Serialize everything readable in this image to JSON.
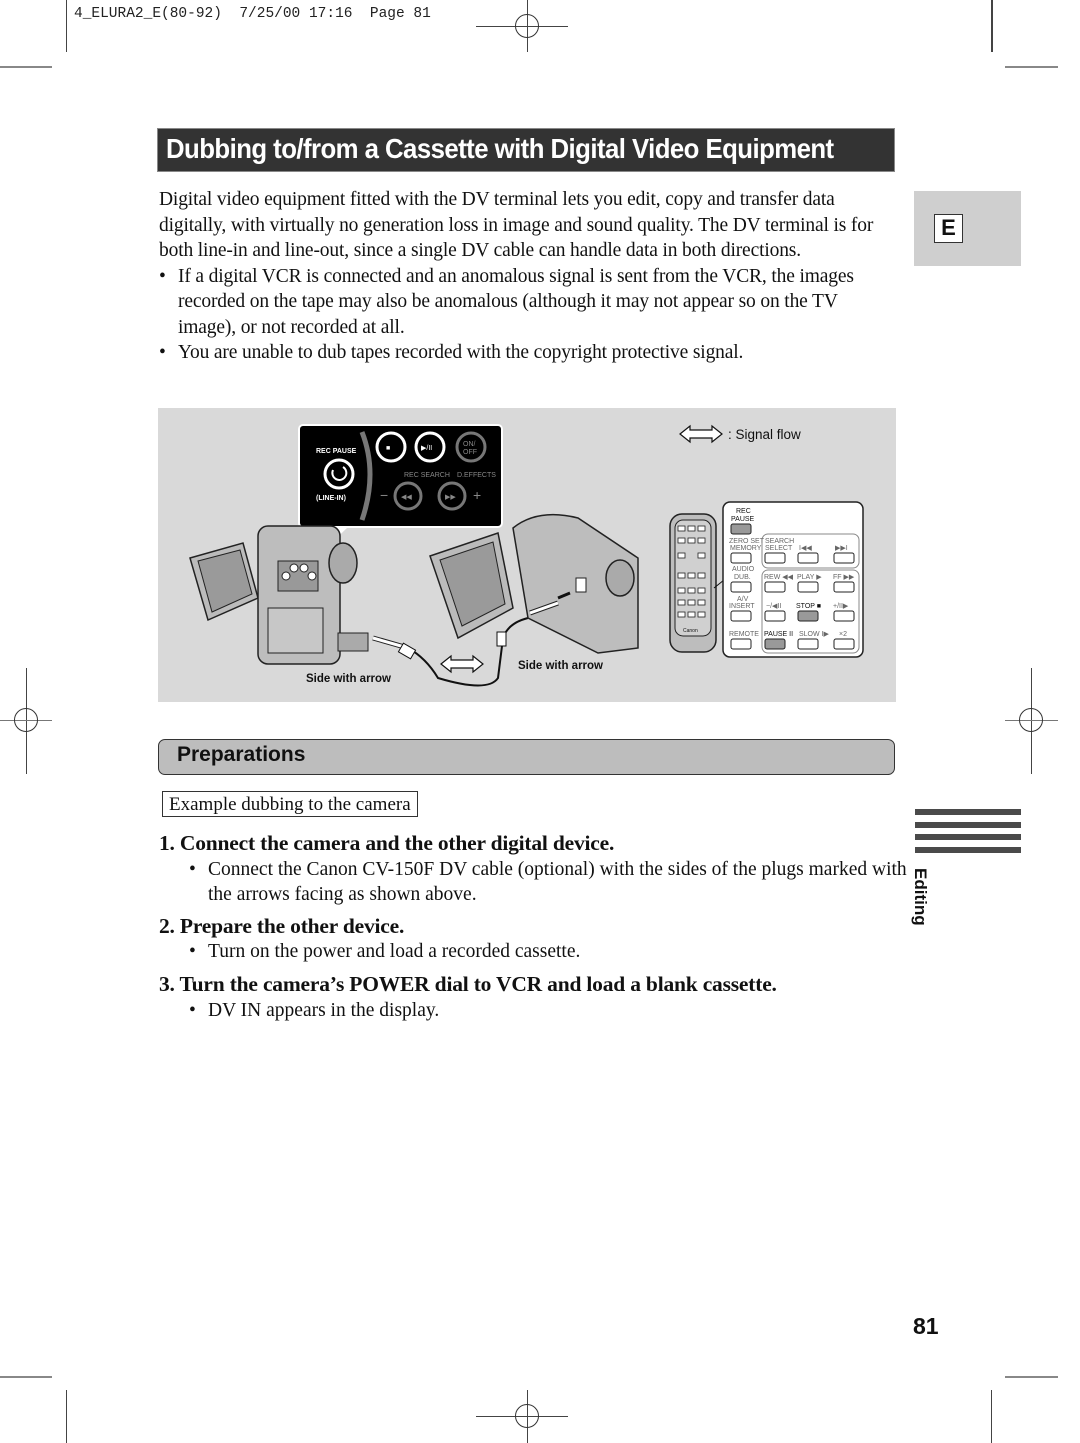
{
  "print_header": {
    "job": "4_ELURA2_E(80-92)",
    "date": "7/25/00",
    "time": "17:16",
    "page_label": "Page",
    "page_ref": "81"
  },
  "title": "Dubbing to/from a Cassette with Digital Video Equipment",
  "language_tab": "E",
  "intro": {
    "paragraph": "Digital video equipment fitted with the DV terminal lets you edit, copy and transfer data digitally, with virtually no generation loss in image and sound quality. The DV terminal is for both line-in and line-out, since a single DV cable can handle data in both directions.",
    "bullets": [
      "If a digital VCR is connected and an anomalous signal is sent from the VCR, the images recorded on the tape may also be anomalous (although it may not appear so on the TV image), or not recorded at all.",
      "You are unable to dub tapes recorded with the copyright protective signal."
    ]
  },
  "figure": {
    "legend": ": Signal flow",
    "label_left": "Side with arrow",
    "label_right": "Side with arrow",
    "camera_panel": {
      "rec_pause": "REC PAUSE",
      "line_in": "(LINE-IN)",
      "on_off_1": "ON/",
      "on_off_2": "OFF",
      "rec_search": "REC SEARCH",
      "d_effects": "D.EFFECTS",
      "minus": "−",
      "plus": "+",
      "stop_glyph": "■",
      "play_pause_glyph": "▶/II",
      "rew_glyph": "◀◀",
      "ff_glyph": "▶▶"
    },
    "remote_panel": {
      "rec": "REC",
      "pause": "PAUSE",
      "zero_set": "ZERO SET",
      "memory": "MEMORY",
      "search": "SEARCH",
      "select": "SELECT",
      "prev": "I◀◀",
      "next": "▶▶I",
      "audio": "AUDIO",
      "dub": "DUB.",
      "rew": "REW ◀◀",
      "play": "PLAY ▶",
      "ff": "FF ▶▶",
      "av": "A/V",
      "insert": "INSERT",
      "minus_frame": "−/◀II",
      "stop": "STOP ■",
      "plus_frame": "+/II▶",
      "remote": "REMOTE",
      "pause_btn": "PAUSE II",
      "slow": "SLOW I▶",
      "x2": "×2",
      "brand": "Canon"
    }
  },
  "preparations": {
    "heading": "Preparations",
    "example": "Example dubbing to the camera",
    "steps": [
      {
        "title": "1.  Connect the camera and the other digital device.",
        "bullets": [
          "Connect the Canon CV-150F DV cable (optional) with the sides of the plugs marked with the arrows facing as shown above."
        ]
      },
      {
        "title": "2.  Prepare the other device.",
        "bullets": [
          "Turn on the power and load a recorded cassette."
        ]
      },
      {
        "title": "3.  Turn the camera’s POWER dial to VCR and load a blank cassette.",
        "bullets": [
          "DV IN appears in the display."
        ]
      }
    ]
  },
  "side_section": "Editing",
  "page_number": "81"
}
